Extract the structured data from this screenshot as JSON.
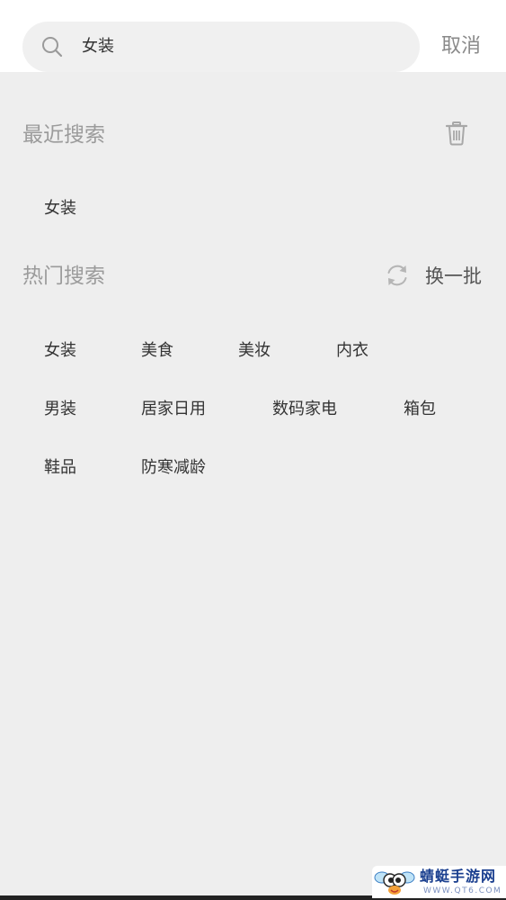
{
  "search": {
    "value": "女装",
    "cancel_label": "取消"
  },
  "recent": {
    "title": "最近搜索",
    "items": [
      "女装"
    ]
  },
  "hot": {
    "title": "热门搜索",
    "refresh_label": "换一批",
    "items": [
      "女装",
      "美食",
      "美妆",
      "内衣",
      "男装",
      "居家日用",
      "数码家电",
      "箱包",
      "鞋品",
      "防寒减龄"
    ]
  },
  "icons": {
    "search": "search-icon",
    "trash": "trash-icon",
    "refresh": "refresh-icon"
  },
  "watermark": {
    "title": "蜻蜓手游网",
    "url": "WWW.QT6.COM"
  }
}
